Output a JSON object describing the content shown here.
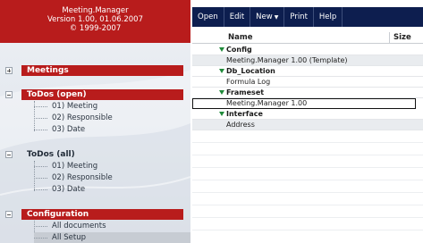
{
  "app": {
    "title_line1": "Meeting.Manager",
    "title_line2": "Version 1.00, 01.06.2007",
    "title_line3": "© 1999-2007"
  },
  "nav": {
    "meetings": {
      "label": "Meetings"
    },
    "todos_open": {
      "label": "ToDos (open)",
      "items": [
        "01) Meeting",
        "02) Responsible",
        "03) Date"
      ]
    },
    "todos_all": {
      "label": "ToDos (all)",
      "items": [
        "01) Meeting",
        "02) Responsible",
        "03) Date"
      ]
    },
    "configuration": {
      "label": "Configuration",
      "items": [
        "All documents",
        "All Setup"
      ]
    }
  },
  "toolbar": {
    "open": "Open",
    "edit": "Edit",
    "new": "New",
    "print": "Print",
    "help": "Help"
  },
  "view": {
    "columns": {
      "name": "Name",
      "size": "Size"
    },
    "groups": [
      {
        "category": "Config",
        "docs": [
          "Meeting.Manager 1.00 (Template)"
        ]
      },
      {
        "category": "Db_Location",
        "docs": [
          "Formula Log"
        ]
      },
      {
        "category": "Frameset",
        "docs": [
          "Meeting.Manager 1.00"
        ]
      },
      {
        "category": "Interface",
        "docs": [
          "Address"
        ]
      }
    ]
  },
  "colors": {
    "brand_red": "#b81c1c",
    "toolbar_navy": "#0d1e4f",
    "category_twistie": "#1f8a3a"
  }
}
